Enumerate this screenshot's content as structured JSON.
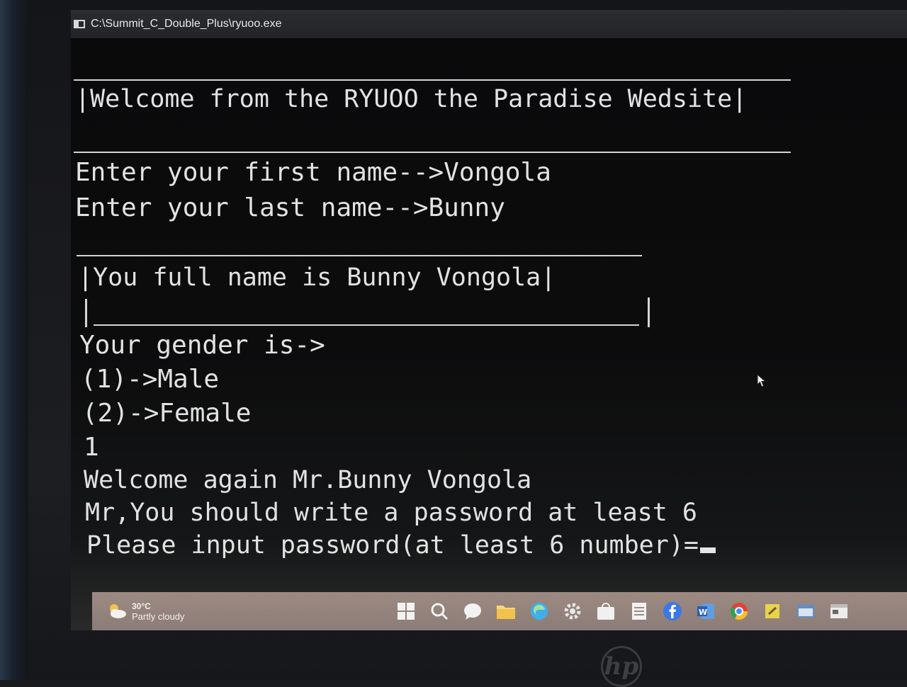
{
  "window": {
    "title": "C:\\Summit_C_Double_Plus\\ryuoo.exe"
  },
  "console": {
    "lines": [
      "|Welcome from the RYUOO the Paradise Wedsite|",
      "Enter your first name-->Vongola",
      "Enter your last name-->Bunny",
      "|You full name is Bunny Vongola|",
      "Your gender is->",
      "(1)->Male",
      "(2)->Female",
      "1",
      "Welcome again Mr.Bunny Vongola",
      "Mr,You should write a password at least 6",
      "Please input password(at least 6 number)="
    ]
  },
  "taskbar": {
    "weather_temp": "30°C",
    "weather_desc": "Partly cloudy",
    "icons": [
      "windows-start-icon",
      "search-icon",
      "chat-icon",
      "file-explorer-icon",
      "edge-browser-icon",
      "settings-icon",
      "store-icon",
      "notepad-icon",
      "facebook-icon",
      "word-icon",
      "chrome-icon",
      "sticky-app-icon",
      "app-icon",
      "console-app-icon"
    ]
  },
  "laptop": {
    "logo_text": "hp"
  },
  "colors": {
    "console_bg": "#0b0b0c",
    "console_text": "#e2e2e2",
    "taskbar": "#958581",
    "titlebar": "#2b2c2f"
  }
}
